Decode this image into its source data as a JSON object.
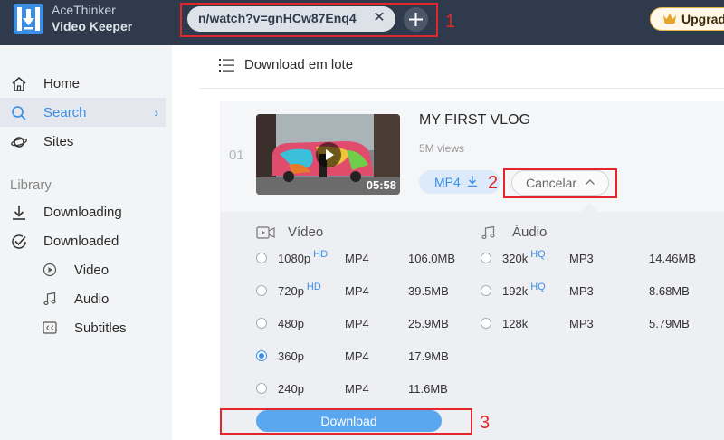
{
  "app": {
    "title_line1": "AceThinker",
    "title_line2": "Video Keeper"
  },
  "topbar": {
    "url_value": "n/watch?v=gnHCw87Enq4",
    "upgrade_label": "Upgrade"
  },
  "annotations": [
    "1",
    "2",
    "3"
  ],
  "colors": {
    "accent": "#3a8ee6",
    "topbar": "#2f3b4d",
    "annotation": "#e2262b",
    "upgrade_border": "#e6b34a"
  },
  "sidebar": {
    "items": [
      {
        "label": "Home",
        "icon": "home-icon"
      },
      {
        "label": "Search",
        "icon": "search-icon",
        "active": true
      },
      {
        "label": "Sites",
        "icon": "planet-icon"
      }
    ],
    "library_label": "Library",
    "library_items": [
      {
        "label": "Downloading",
        "icon": "download-icon"
      },
      {
        "label": "Downloaded",
        "icon": "check-circle-icon"
      }
    ],
    "sub_items": [
      {
        "label": "Video",
        "icon": "play-circle-icon"
      },
      {
        "label": "Audio",
        "icon": "music-note-icon"
      },
      {
        "label": "Subtitles",
        "icon": "cc-icon"
      }
    ]
  },
  "main": {
    "batch_label": "Download em lote",
    "result": {
      "index": "01",
      "title": "MY FIRST VLOG",
      "views": "5M views",
      "duration": "05:58",
      "format_label": "MP4",
      "cancel_label": "Cancelar"
    },
    "video_header": "Vídeo",
    "audio_header": "Áudio",
    "video_options": [
      {
        "quality": "1080p",
        "badge": "HD",
        "format": "MP4",
        "size": "106.0MB",
        "selected": false
      },
      {
        "quality": "720p",
        "badge": "HD",
        "format": "MP4",
        "size": "39.5MB",
        "selected": false
      },
      {
        "quality": "480p",
        "badge": "",
        "format": "MP4",
        "size": "25.9MB",
        "selected": false
      },
      {
        "quality": "360p",
        "badge": "",
        "format": "MP4",
        "size": "17.9MB",
        "selected": true
      },
      {
        "quality": "240p",
        "badge": "",
        "format": "MP4",
        "size": "11.6MB",
        "selected": false
      }
    ],
    "audio_options": [
      {
        "quality": "320k",
        "badge": "HQ",
        "format": "MP3",
        "size": "14.46MB",
        "selected": false
      },
      {
        "quality": "192k",
        "badge": "HQ",
        "format": "MP3",
        "size": "8.68MB",
        "selected": false
      },
      {
        "quality": "128k",
        "badge": "",
        "format": "MP3",
        "size": "5.79MB",
        "selected": false
      }
    ],
    "download_label": "Download"
  }
}
